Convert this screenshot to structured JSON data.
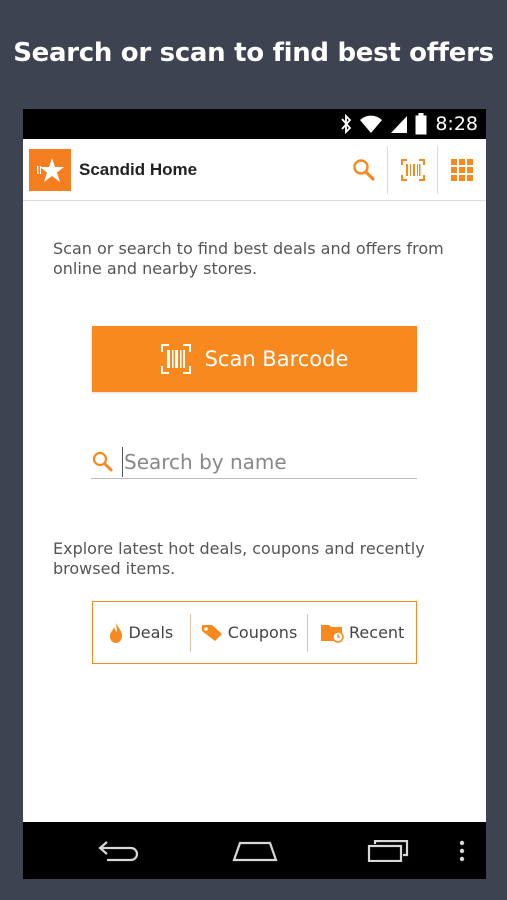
{
  "headline": "Search or scan to find best offers",
  "status_bar": {
    "time": "8:28",
    "icons": [
      "bluetooth-icon",
      "wifi-icon",
      "signal-icon",
      "battery-icon"
    ]
  },
  "action_bar": {
    "title": "Scandid Home",
    "actions": [
      "search-icon",
      "barcode-scan-icon",
      "grid-menu-icon"
    ]
  },
  "intro_text": "Scan or search to find best deals and offers from online and nearby stores.",
  "scan_button": {
    "label": "Scan Barcode",
    "icon": "barcode-icon"
  },
  "search": {
    "placeholder": "Search by name",
    "value": ""
  },
  "explore_text": "Explore latest hot deals, coupons and recently browsed items.",
  "shortcuts": [
    {
      "label": "Deals",
      "icon": "flame-icon"
    },
    {
      "label": "Coupons",
      "icon": "tag-icon"
    },
    {
      "label": "Recent",
      "icon": "folder-clock-icon"
    }
  ],
  "nav_bar": [
    "back-icon",
    "home-icon",
    "recents-icon",
    "overflow-menu-icon"
  ],
  "colors": {
    "accent": "#f7891f",
    "background": "#3d4350",
    "status_bar": "#000000",
    "text": "#555555"
  }
}
